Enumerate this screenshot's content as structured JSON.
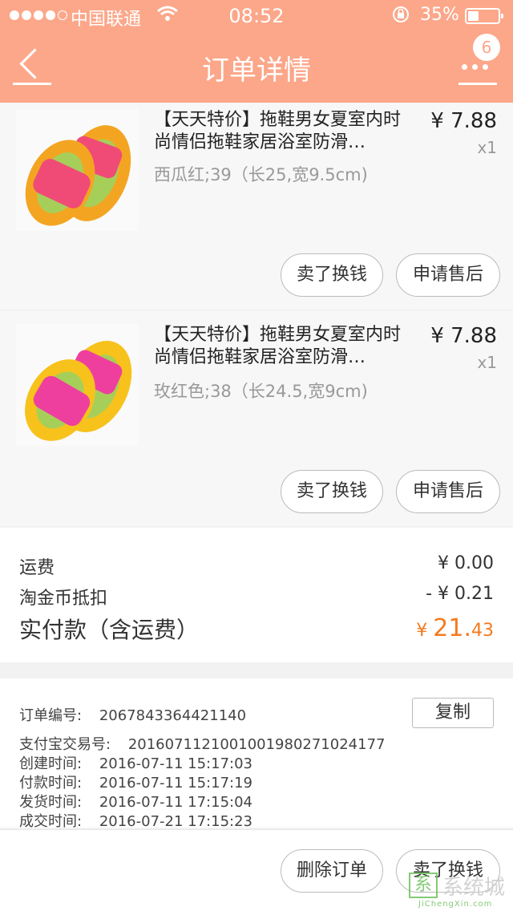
{
  "status_bar": {
    "carrier": "中国联通",
    "time": "08:52",
    "battery": "35%"
  },
  "nav": {
    "title": "订单详情",
    "badge": "6"
  },
  "items": [
    {
      "title": "【天天特价】拖鞋男女夏室内时尚情侣拖鞋家居浴室防滑…",
      "price": "¥ 7.88",
      "qty": "x1",
      "spec": "西瓜红;39（长25,宽9.5cm)",
      "btn_sell": "卖了换钱",
      "btn_service": "申请售后",
      "colors": {
        "body": "#f04b76",
        "sole": "#f3a522",
        "strip": "#a6cf5a"
      }
    },
    {
      "title": "【天天特价】拖鞋男女夏室内时尚情侣拖鞋家居浴室防滑…",
      "price": "¥ 7.88",
      "qty": "x1",
      "spec": "玫红色;38（长24.5,宽9cm)",
      "btn_sell": "卖了换钱",
      "btn_service": "申请售后",
      "colors": {
        "body": "#ee3f9e",
        "sole": "#f7c21c",
        "strip": "#a6cf5a"
      }
    }
  ],
  "summary": {
    "shipping_label": "运费",
    "shipping_value": "¥ 0.00",
    "coin_label": "淘金币抵扣",
    "coin_value": "- ¥ 0.21",
    "paid_label": "实付款（含运费）",
    "paid_currency": "¥",
    "paid_int": "21.",
    "paid_dec": "43"
  },
  "order_info": {
    "order_no_label": "订单编号:",
    "order_no": "2067843364421140",
    "copy": "复制",
    "alipay_label": "支付宝交易号:",
    "alipay_no": "2016071121001001980271024177",
    "created_label": "创建时间:",
    "created": "2016-07-11 15:17:03",
    "paid_label": "付款时间:",
    "paid": "2016-07-11 15:17:19",
    "shipped_label": "发货时间:",
    "shipped": "2016-07-11 17:15:04",
    "deal_label": "成交时间:",
    "deal": "2016-07-21 17:15:23"
  },
  "footer": {
    "delete": "删除订单",
    "sell": "卖了换钱"
  },
  "watermark": {
    "box": "系",
    "text": "系统城",
    "url": "JiChengXin.com"
  },
  "theme": {
    "accent": "#fca78a",
    "price_orange": "#f47a1f"
  }
}
